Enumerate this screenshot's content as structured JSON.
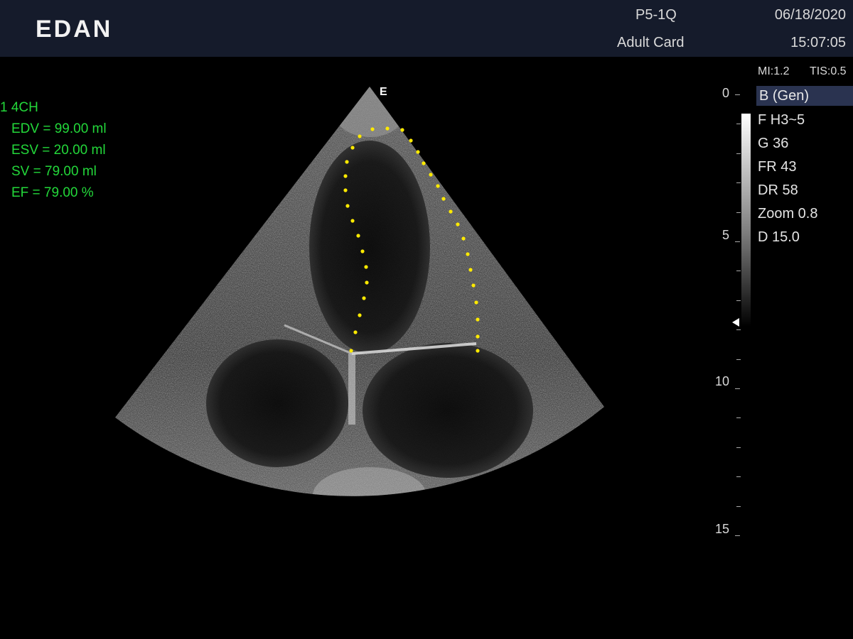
{
  "header": {
    "brand": "EDAN",
    "probe": "P5-1Q",
    "preset": "Adult Card",
    "date": "06/18/2020",
    "time": "15:07:05"
  },
  "indices": {
    "mi": "MI:1.2",
    "tis": "TIS:0.5"
  },
  "imaging": {
    "mode": "B (Gen)",
    "params": [
      "F H3~5",
      "G 36",
      "FR 43",
      "DR 58",
      "Zoom 0.8",
      "D 15.0"
    ],
    "depth_labels": [
      "0",
      "5",
      "10",
      "15"
    ],
    "orientation_mark": "E"
  },
  "measurement": {
    "title": "1 4CH",
    "rows": [
      "EDV = 99.00 ml",
      "ESV = 20.00 ml",
      "SV = 79.00 ml",
      "EF = 79.00 %"
    ]
  },
  "colors": {
    "header_bg": "#151b2b",
    "mode_highlight": "#2a3350",
    "measurement_text": "#23d83a",
    "trace_dots": "#ffea00"
  }
}
